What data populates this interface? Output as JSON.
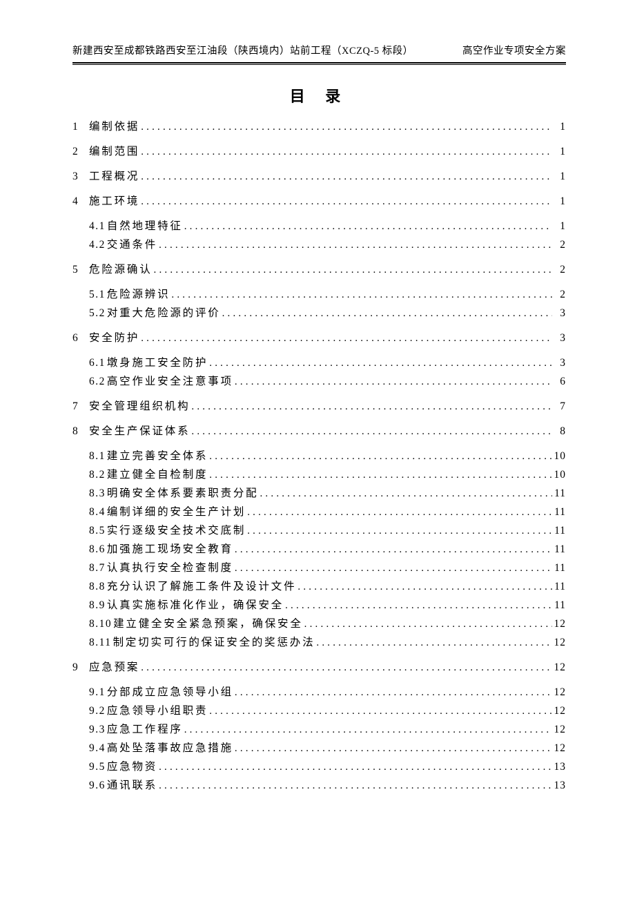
{
  "header": {
    "left": "新建西安至成都铁路西安至江油段（陕西境内）站前工程（XCZQ-5 标段）",
    "right": "高空作业专项安全方案"
  },
  "title": "目  录",
  "dots": "................................................................................................................................",
  "toc": [
    {
      "level": 1,
      "num": "1",
      "label": "编制依据",
      "page": "1"
    },
    {
      "level": 1,
      "num": "2",
      "label": "编制范围",
      "page": "1"
    },
    {
      "level": 1,
      "num": "3",
      "label": "工程概况",
      "page": "1"
    },
    {
      "level": 1,
      "num": "4",
      "label": "施工环境",
      "page": "1"
    },
    {
      "level": 2,
      "num": "4.1",
      "label": "自然地理特征",
      "page": "1",
      "first": true
    },
    {
      "level": 2,
      "num": "4.2",
      "label": "交通条件",
      "page": "2"
    },
    {
      "level": 1,
      "num": "5",
      "label": "危险源确认",
      "page": "2"
    },
    {
      "level": 2,
      "num": "5.1",
      "label": "危险源辨识",
      "page": "2",
      "first": true
    },
    {
      "level": 2,
      "num": "5.2",
      "label": "对重大危险源的评价",
      "page": "3"
    },
    {
      "level": 1,
      "num": "6",
      "label": "安全防护",
      "page": "3"
    },
    {
      "level": 2,
      "num": "6.1",
      "label": "墩身施工安全防护",
      "page": "3",
      "first": true
    },
    {
      "level": 2,
      "num": "6.2",
      "label": "高空作业安全注意事项",
      "page": "6"
    },
    {
      "level": 1,
      "num": "7",
      "label": "安全管理组织机构",
      "page": "7"
    },
    {
      "level": 1,
      "num": "8",
      "label": "安全生产保证体系",
      "page": "8"
    },
    {
      "level": 2,
      "num": "8.1",
      "label": "建立完善安全体系",
      "page": "10",
      "first": true
    },
    {
      "level": 2,
      "num": "8.2",
      "label": "建立健全自检制度",
      "page": "10"
    },
    {
      "level": 2,
      "num": "8.3",
      "label": "明确安全体系要素职责分配",
      "page": "11"
    },
    {
      "level": 2,
      "num": "8.4",
      "label": "编制详细的安全生产计划",
      "page": "11"
    },
    {
      "level": 2,
      "num": "8.5",
      "label": "实行逐级安全技术交底制",
      "page": "11"
    },
    {
      "level": 2,
      "num": "8.6",
      "label": "加强施工现场安全教育",
      "page": "11"
    },
    {
      "level": 2,
      "num": "8.7",
      "label": "认真执行安全检查制度",
      "page": "11"
    },
    {
      "level": 2,
      "num": "8.8",
      "label": "充分认识了解施工条件及设计文件",
      "page": "11"
    },
    {
      "level": 2,
      "num": "8.9",
      "label": "认真实施标准化作业，确保安全",
      "page": "11"
    },
    {
      "level": 2,
      "num": "8.10",
      "label": "建立健全安全紧急预案，确保安全",
      "page": "12"
    },
    {
      "level": 2,
      "num": "8.11",
      "label": "制定切实可行的保证安全的奖惩办法",
      "page": "12"
    },
    {
      "level": 1,
      "num": "9",
      "label": "应急预案",
      "page": "12"
    },
    {
      "level": 2,
      "num": "9.1",
      "label": "分部成立应急领导小组",
      "page": "12",
      "first": true
    },
    {
      "level": 2,
      "num": "9.2",
      "label": "应急领导小组职责",
      "page": "12"
    },
    {
      "level": 2,
      "num": "9.3",
      "label": "应急工作程序",
      "page": "12"
    },
    {
      "level": 2,
      "num": "9.4",
      "label": "高处坠落事故应急措施",
      "page": "12"
    },
    {
      "level": 2,
      "num": "9.5",
      "label": "应急物资",
      "page": "13"
    },
    {
      "level": 2,
      "num": "9.6",
      "label": "通讯联系",
      "page": "13"
    }
  ]
}
